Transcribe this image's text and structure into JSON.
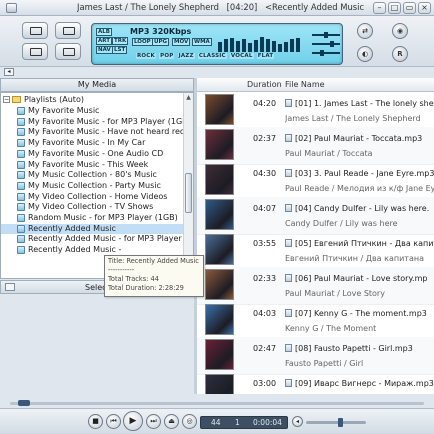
{
  "titlebar": {
    "now_playing": "James Last / The Lonely Shepherd",
    "time": "[04:20]",
    "scrolling_text": "<Recently Added Music - yet to be rat..."
  },
  "lcd": {
    "bitrate": "MP3 320Kbps",
    "tags": [
      "ALB",
      "ART",
      "NAV",
      "TRK",
      "LST",
      "LOOP",
      "UPG",
      "MOV",
      "WMA"
    ],
    "eq_presets": [
      "ROCK",
      "POP",
      "JAZZ",
      "CLASSIC",
      "VOCAL",
      "FLAT"
    ],
    "eq_levels": [
      0.55,
      0.7,
      0.8,
      0.6,
      0.75,
      0.5,
      0.65,
      0.85,
      0.7,
      0.6,
      0.45,
      0.55,
      0.7,
      0.8
    ]
  },
  "media_panel": {
    "header": "My Media",
    "root": "Playlists (Auto)",
    "items": [
      "My Favorite Music",
      "My Favorite Music - for MP3 Player (1GB)",
      "My Favorite Music - Have not heard recently",
      "My Favorite Music - In My Car",
      "My Favorite Music - One Audio CD",
      "My Favorite Music - This Week",
      "My Music Collection - 80's Music",
      "My Music Collection - Party Music",
      "My Video Collection - Home Videos",
      "My Video Collection - TV Shows",
      "Random Music - for MP3 Player (1GB)",
      "Recently Added Music",
      "Recently Added Music - for MP3 Player (1GB",
      "Recently Added Music - "
    ],
    "selected_index": 11,
    "footer_label": "Select"
  },
  "tooltip": {
    "title": "Title: Recently Added Music",
    "separator": "-----------",
    "tracks": "Total Tracks: 44",
    "duration": "Total Duration: 2:28:29"
  },
  "table": {
    "col_duration": "Duration",
    "col_filename": "File Name",
    "rows": [
      {
        "duration": "04:20",
        "file": "[01] 1. James Last - The lonely shepherd",
        "artist": "James Last / The Lonely Shepherd",
        "art": "#7a4a2e"
      },
      {
        "duration": "02:37",
        "file": "[02] Paul Mauriat - Toccata.mp3",
        "artist": "Paul Mauriat / Toccata",
        "art": "#6d2e3a"
      },
      {
        "duration": "04:30",
        "file": "[03] 3. Paul Reade - Jane Eyre.mp3",
        "artist": "Paul Reade / Мелодия из к/ф Jane Eyre",
        "art": "#3f2c36"
      },
      {
        "duration": "04:07",
        "file": "[04] Candy Dulfer - Lily was here.",
        "artist": "Candy Dulfer / Lily was here",
        "art": "#2f5a87"
      },
      {
        "duration": "03:55",
        "file": "[05] Евгений Птичкин - Два капитана",
        "artist": "Евгений Птичкин / Два капитана",
        "art": "#4b6d96"
      },
      {
        "duration": "02:33",
        "file": "[06] Paul Mauriat - Love story.mp",
        "artist": "Paul Mauriat / Love Story",
        "art": "#8a5a3a"
      },
      {
        "duration": "04:03",
        "file": "[07] Kenny G - The moment.mp3",
        "artist": "Kenny G / The Moment",
        "art": "#3b6fa8"
      },
      {
        "duration": "02:47",
        "file": "[08] Fausto Papetti - Girl.mp3",
        "artist": "Fausto Papetti / Girl",
        "art": "#6a2036"
      },
      {
        "duration": "03:00",
        "file": "[09] Иварс Вигнерс - Мираж.mp3",
        "artist": "Иварс Вигнерс / Мираж",
        "art": "#2e2e3e"
      },
      {
        "duration": "03:07",
        "file": "[10] Fausto Papetti - ...",
        "artist": "",
        "art": "#8a3b52"
      }
    ]
  },
  "controls": {
    "track_number": "44",
    "current": "1",
    "elapsed": "0:00:04",
    "seek_position": 0.02,
    "volume": 0.55
  }
}
